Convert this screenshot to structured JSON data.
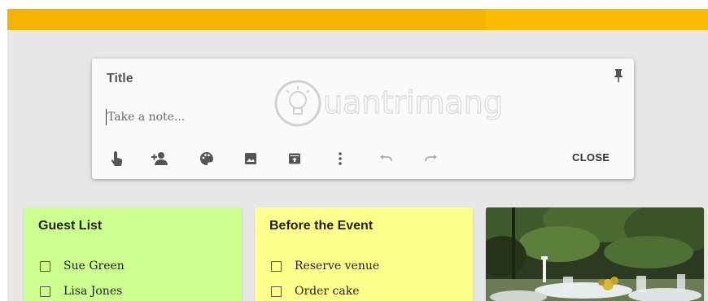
{
  "composer": {
    "title": "Title",
    "note_placeholder": "Take a note...",
    "watermark": "uantrimang",
    "close_label": "CLOSE",
    "tools": [
      "reminder-icon",
      "collaborator-icon",
      "palette-icon",
      "image-icon",
      "archive-icon",
      "more-icon",
      "undo-icon",
      "redo-icon"
    ]
  },
  "notes": [
    {
      "title": "Guest List",
      "color": "#ccff90",
      "items": [
        "Sue Green",
        "Lisa Jones"
      ]
    },
    {
      "title": "Before the Event",
      "color": "#ffff8d",
      "items": [
        "Reserve venue",
        "Order cake"
      ]
    }
  ],
  "colors": {
    "header": "#fbbc04",
    "background": "#e7e7e7"
  }
}
